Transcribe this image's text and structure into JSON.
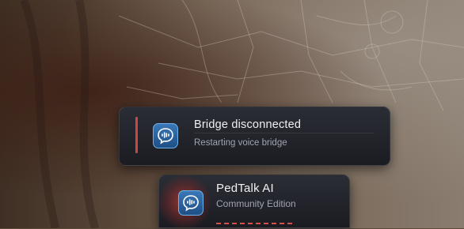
{
  "notifications": [
    {
      "title": "Bridge disconnected",
      "subtitle": "Restarting voice bridge",
      "icon": "voice-chat-icon",
      "accent_color": "#c94845"
    },
    {
      "title": "PedTalk AI",
      "subtitle": "Community Edition",
      "icon": "voice-chat-icon",
      "accent_color": "#d8504a"
    }
  ]
}
